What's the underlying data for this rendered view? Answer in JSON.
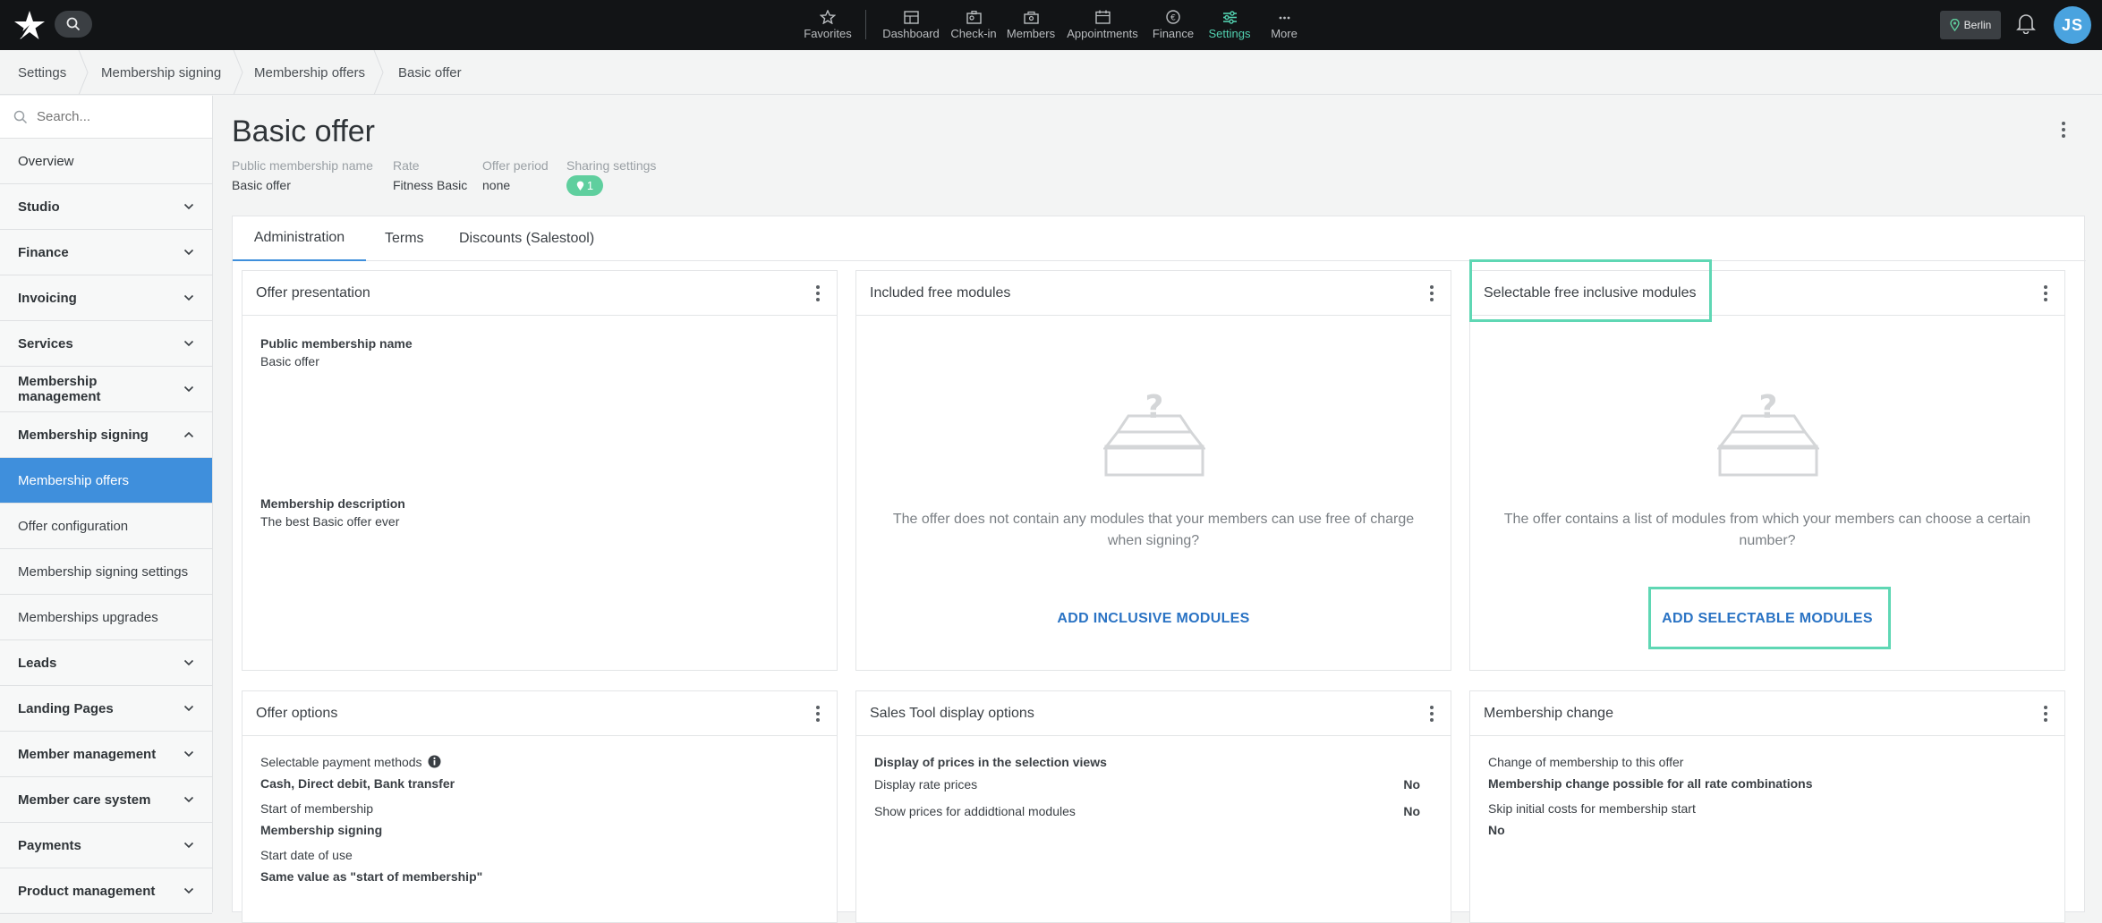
{
  "topbar": {
    "nav": [
      {
        "label": "Favorites",
        "icon": "star-icon"
      },
      {
        "label": "Dashboard",
        "icon": "dashboard-icon"
      },
      {
        "label": "Check-in",
        "icon": "checkin-icon"
      },
      {
        "label": "Members",
        "icon": "members-icon"
      },
      {
        "label": "Appointments",
        "icon": "calendar-icon"
      },
      {
        "label": "Finance",
        "icon": "euro-icon"
      },
      {
        "label": "Settings",
        "icon": "sliders-icon"
      },
      {
        "label": "More",
        "icon": "more-icon"
      }
    ],
    "location": "Berlin",
    "avatar_initials": "JS",
    "accent": "#52d1b0"
  },
  "breadcrumb": [
    "Settings",
    "Membership signing",
    "Membership offers",
    "Basic offer"
  ],
  "sidebar": {
    "search_placeholder": "Search...",
    "items": [
      {
        "label": "Overview"
      },
      {
        "label": "Studio"
      },
      {
        "label": "Finance"
      },
      {
        "label": "Invoicing"
      },
      {
        "label": "Services"
      },
      {
        "label": "Membership management"
      },
      {
        "label": "Membership signing"
      },
      {
        "label": "Membership offers"
      },
      {
        "label": "Offer configuration"
      },
      {
        "label": "Membership signing settings"
      },
      {
        "label": "Memberships upgrades"
      },
      {
        "label": "Leads"
      },
      {
        "label": "Landing Pages"
      },
      {
        "label": "Member management"
      },
      {
        "label": "Member care system"
      },
      {
        "label": "Payments"
      },
      {
        "label": "Product management"
      }
    ]
  },
  "header": {
    "title": "Basic offer",
    "meta": [
      {
        "label": "Public membership name",
        "value": "Basic offer"
      },
      {
        "label": "Rate",
        "value": "Fitness Basic"
      },
      {
        "label": "Offer period",
        "value": "none"
      },
      {
        "label": "Sharing settings",
        "value": "1"
      }
    ]
  },
  "tabs": [
    "Administration",
    "Terms",
    "Discounts (Salestool)"
  ],
  "cards": {
    "offer_presentation": {
      "title": "Offer presentation",
      "name_label": "Public membership name",
      "name_value": "Basic offer",
      "desc_label": "Membership description",
      "desc_value": "The best Basic offer ever"
    },
    "included_free": {
      "title": "Included free modules",
      "empty_text": "The offer does not contain any modules that your members can use free of charge when signing?",
      "action": "ADD INCLUSIVE MODULES"
    },
    "selectable_free": {
      "title": "Selectable free inclusive modules",
      "empty_text": "The offer contains a list of modules from which your members can choose a certain number?",
      "action": "ADD SELECTABLE MODULES"
    },
    "offer_options": {
      "title": "Offer options",
      "payment_label": "Selectable payment methods",
      "payment_value": "Cash, Direct debit, Bank transfer",
      "start_label": "Start of membership",
      "start_value": "Membership signing",
      "use_label": "Start date of use",
      "use_value": "Same value as \"start of membership\""
    },
    "sales_tool": {
      "title": "Sales Tool display options",
      "heading": "Display of prices in the selection views",
      "rows": [
        {
          "label": "Display rate prices",
          "value": "No"
        },
        {
          "label": "Show prices for addidtional modules",
          "value": "No"
        }
      ]
    },
    "membership_change": {
      "title": "Membership change",
      "change_label": "Change of membership to this offer",
      "change_value": "Membership change possible for all rate combinations",
      "skip_label": "Skip initial costs for membership start",
      "skip_value": "No"
    }
  }
}
